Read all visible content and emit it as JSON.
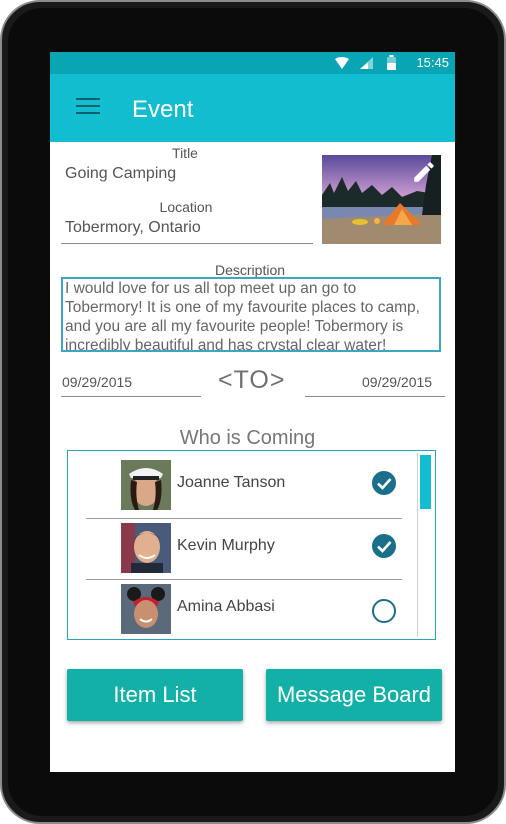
{
  "status_bar": {
    "time": "15:45",
    "icons": [
      "wifi-icon",
      "signal-icon",
      "battery-icon"
    ]
  },
  "app_bar": {
    "title": "Event",
    "menu_icon": "hamburger-menu-icon"
  },
  "form": {
    "title_label": "Title",
    "title_value": "Going Camping",
    "location_label": "Location",
    "location_value": "Tobermory, Ontario",
    "description_label": "Description",
    "description_value": "I would love for us all top meet up an go to Tobermory! It is one of my favourite places to camp, and you are all my favourite people! Tobermory is incredibly beautiful and has crystal clear water!",
    "start_date": "09/29/2015",
    "to_label": "<TO>",
    "end_date": "09/29/2015"
  },
  "photo": {
    "subject": "campsite-photo",
    "edit_icon": "pencil-icon"
  },
  "attendees": {
    "heading": "Who is Coming",
    "people": [
      {
        "name": "Joanne Tanson",
        "checked": true
      },
      {
        "name": "Kevin Murphy",
        "checked": true
      },
      {
        "name": "Amina Abbasi",
        "checked": false
      }
    ]
  },
  "buttons": {
    "item_list": "Item List",
    "message_board": "Message Board"
  },
  "colors": {
    "status_bar": "#0aa5b4",
    "app_bar": "#12bdd0",
    "button": "#12b0a6",
    "check": "#1a6f8a"
  }
}
